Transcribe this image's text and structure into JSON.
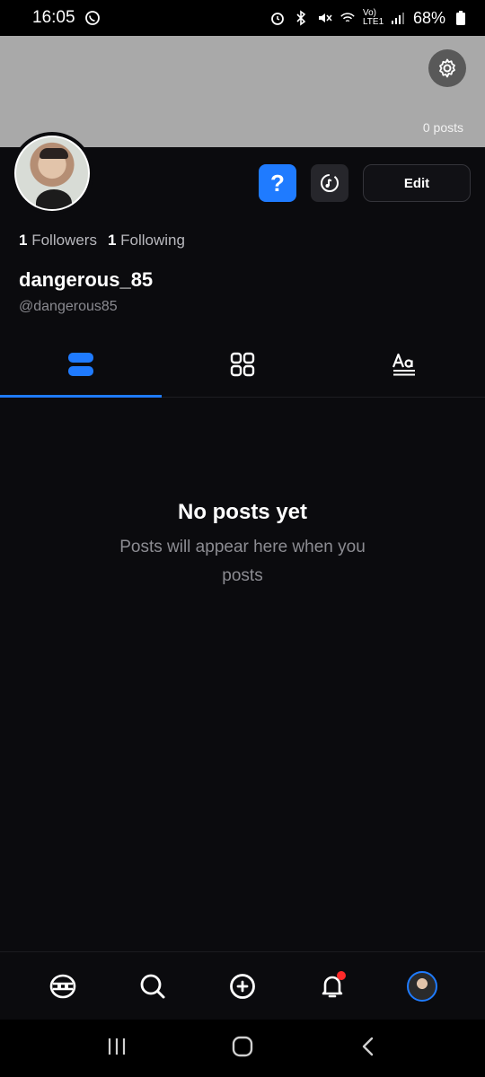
{
  "status_bar": {
    "time": "16:05",
    "battery": "68%",
    "network": "Vo) LTE1",
    "icons": [
      "whatsapp-icon",
      "alarm-icon",
      "bluetooth-icon",
      "mute-icon",
      "wifi-icon",
      "signal-icon",
      "battery-icon"
    ]
  },
  "profile": {
    "posts_count": "0 posts",
    "followers_count": "1",
    "followers_label": "Followers",
    "following_count": "1",
    "following_label": "Following",
    "display_name": "dangerous_85",
    "handle": "@dangerous85"
  },
  "actions": {
    "help_label": "?",
    "edit_label": "Edit"
  },
  "tabs": [
    {
      "name": "posts-list",
      "icon": "list-icon",
      "active": true
    },
    {
      "name": "grid",
      "icon": "grid-icon",
      "active": false
    },
    {
      "name": "text",
      "icon": "text-icon",
      "active": false
    }
  ],
  "empty_state": {
    "title": "No posts yet",
    "subtitle": "Posts will appear here when you posts"
  },
  "colors": {
    "accent": "#1f7bff",
    "background": "#0b0b0e",
    "cover": "#a9a9a9",
    "notification": "#ff2a2a"
  },
  "bottom_nav": [
    "home-icon",
    "search-icon",
    "add-post-icon",
    "notifications-icon",
    "profile-avatar"
  ],
  "system_nav": [
    "recent-apps-icon",
    "home-button-icon",
    "back-icon"
  ]
}
